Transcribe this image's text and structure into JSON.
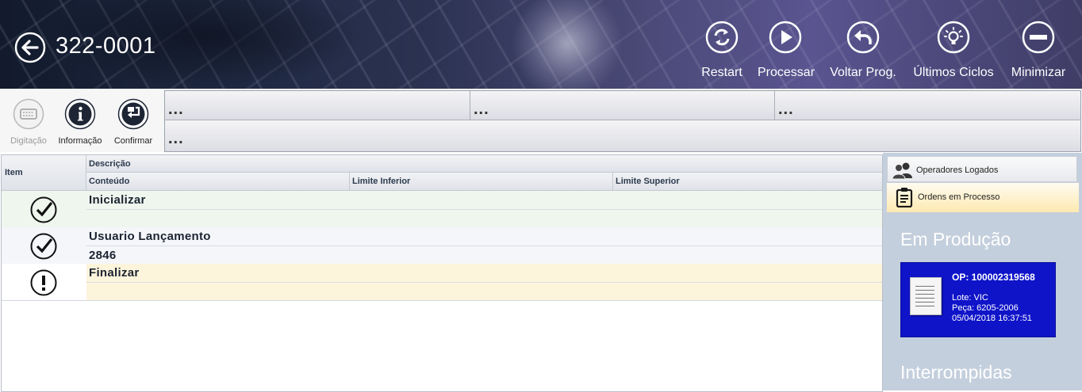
{
  "header": {
    "station": "322-0001",
    "buttons": [
      {
        "label": "Restart",
        "icon": "restart-icon"
      },
      {
        "label": "Processar",
        "icon": "play-icon"
      },
      {
        "label": "Voltar Prog.",
        "icon": "undo-icon"
      },
      {
        "label": "Últimos Ciclos",
        "icon": "lightbulb-icon"
      },
      {
        "label": "Minimizar",
        "icon": "minus-icon"
      }
    ]
  },
  "tools": [
    {
      "label": "Digitação",
      "icon": "keyboard-icon",
      "enabled": false
    },
    {
      "label": "Informação",
      "icon": "info-icon",
      "enabled": true
    },
    {
      "label": "Confirmar",
      "icon": "enter-icon",
      "enabled": true
    }
  ],
  "fields": [
    "...",
    "...",
    "...",
    "..."
  ],
  "grid": {
    "columns": {
      "item": "Item",
      "descricao": "Descrição",
      "conteudo": "Conteúdo",
      "limite_inferior": "Limite Inferior",
      "limite_superior": "Limite Superior"
    },
    "rows": [
      {
        "status": "ok",
        "icon": "check-circle-icon",
        "descricao": "Inicializar",
        "conteudo": ""
      },
      {
        "status": "ok",
        "icon": "check-circle-icon",
        "descricao": "Usuario Lançamento",
        "conteudo": "2846"
      },
      {
        "status": "pending",
        "icon": "exclamation-circle-icon",
        "descricao": "Finalizar",
        "conteudo": ""
      }
    ]
  },
  "right_panel": {
    "tabs": [
      {
        "label": "Operadores Logados",
        "icon": "users-icon"
      },
      {
        "label": "Ordens em Processo",
        "icon": "clipboard-icon"
      }
    ],
    "em_producao": "Em Produção",
    "card": {
      "op": "OP: 100002319568",
      "lote": "Lote: VIC",
      "peca": "Peça: 6205-2006",
      "data": "05/04/2018 16:37:51"
    },
    "interrompidas": "Interrompidas"
  }
}
